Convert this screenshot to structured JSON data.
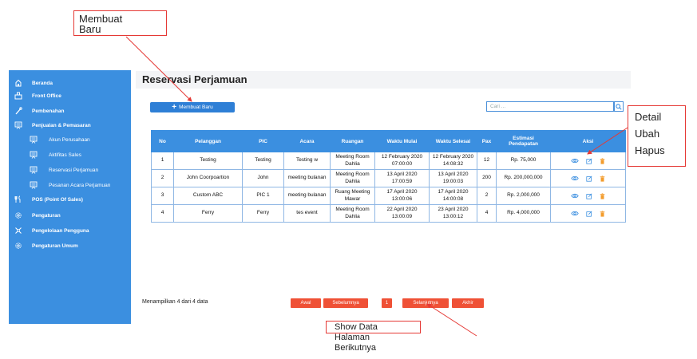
{
  "sidebar": {
    "items": [
      {
        "label": "Beranda",
        "icon": "home-icon"
      },
      {
        "label": "Front Office",
        "icon": "desk-icon"
      },
      {
        "label": "Pembenahan",
        "icon": "tools-icon"
      },
      {
        "label": "Penjualan & Pemasaran",
        "icon": "presentation-icon"
      },
      {
        "label": "Akun Perusahaan",
        "icon": "presentation-icon"
      },
      {
        "label": "Aktifitas Sales",
        "icon": "presentation-icon"
      },
      {
        "label": "Reservasi Perjamuan",
        "icon": "presentation-icon"
      },
      {
        "label": "Pesanan Acara Perjamuan",
        "icon": "presentation-icon"
      },
      {
        "label": "POS (Point Of Sales)",
        "icon": "pos-icon"
      },
      {
        "label": "Pengaturan",
        "icon": "gear-icon"
      },
      {
        "label": "Pengelolaan Pengguna",
        "icon": "users-icon"
      },
      {
        "label": "Pengaturan Umum",
        "icon": "gear-icon"
      }
    ]
  },
  "main": {
    "title": "Reservasi Perjamuan",
    "new_button_label": "Membuat Baru",
    "new_button_icon": "+",
    "search_placeholder": "Cari ..."
  },
  "table": {
    "headers": [
      "No",
      "Pelanggan",
      "PIC",
      "Acara",
      "Ruangan",
      "Waktu Mulai",
      "Waktu Selesai",
      "Pax",
      "Estimasi Pendapatan",
      "Aksi"
    ],
    "rows": [
      [
        "1",
        "Testing",
        "Testing",
        "Testing w",
        "Meeting Room Dahlia",
        "12 February 2020 07:00:00",
        "12 February 2020 14:08:32",
        "12",
        "Rp. 75,000"
      ],
      [
        "2",
        "John Coorpoartion",
        "John",
        "meeting bulanan",
        "Meeting Room Dahlia",
        "13 April 2020 17:00:59",
        "13 April 2020 19:00:03",
        "200",
        "Rp. 200,000,000"
      ],
      [
        "3",
        "Custom ABC",
        "PIC 1",
        "meeting bulanan",
        "Ruang Meeting Mawar",
        "17 April 2020 13:00:06",
        "17 April 2020 14:00:08",
        "2",
        "Rp. 2,000,000"
      ],
      [
        "4",
        "Ferry",
        "Ferry",
        "tes event",
        "Meeting Room Dahlia",
        "22 April 2020 13:00:09",
        "23 April 2020 13:00:12",
        "4",
        "Rp. 4,000,000"
      ]
    ]
  },
  "footer": {
    "showing_text": "Menampilkan 4 dari 4 data",
    "pagination": {
      "first": "Awal",
      "prev": "Sebelumnya",
      "current": "1",
      "next": "Selanjutnya",
      "last": "Akhir"
    }
  },
  "annotations": {
    "membuat_baru": [
      "Membuat",
      "Baru"
    ],
    "detail_ubah_hapus": [
      "Detail",
      "Ubah",
      "Hapus"
    ],
    "show_data": [
      "Show Data",
      "Halaman",
      "Berikutnya"
    ]
  },
  "colors": {
    "primary": "#3b8fe0",
    "pagination": "#ef5136",
    "annotation": "#e53935"
  }
}
